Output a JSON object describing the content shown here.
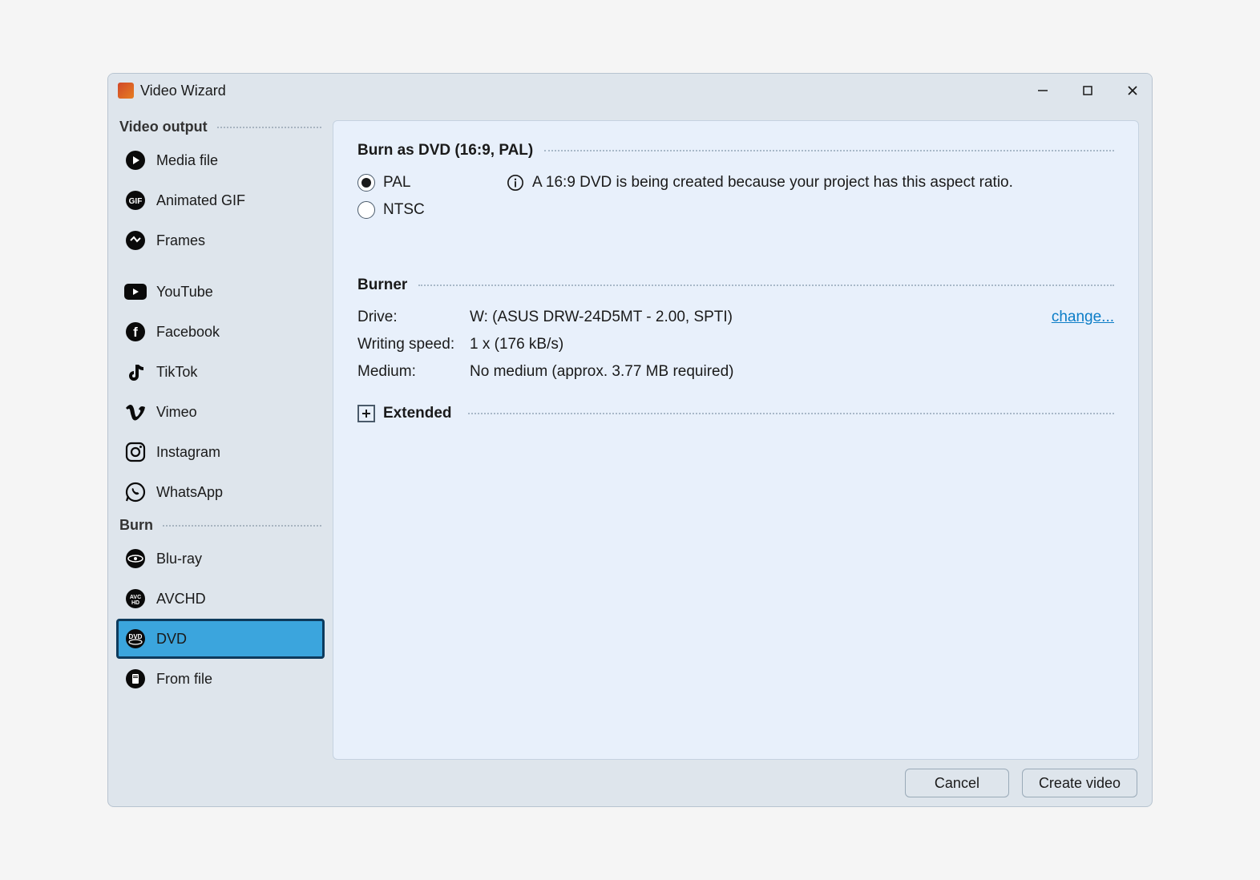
{
  "window": {
    "title": "Video Wizard"
  },
  "sidebar": {
    "sections": [
      {
        "title": "Video output",
        "items": [
          {
            "id": "media-file",
            "label": "Media file",
            "icon": "play-circle"
          },
          {
            "id": "animated-gif",
            "label": "Animated GIF",
            "icon": "gif"
          },
          {
            "id": "frames",
            "label": "Frames",
            "icon": "frames"
          },
          {
            "id": "youtube",
            "label": "YouTube",
            "icon": "youtube"
          },
          {
            "id": "facebook",
            "label": "Facebook",
            "icon": "facebook"
          },
          {
            "id": "tiktok",
            "label": "TikTok",
            "icon": "tiktok"
          },
          {
            "id": "vimeo",
            "label": "Vimeo",
            "icon": "vimeo"
          },
          {
            "id": "instagram",
            "label": "Instagram",
            "icon": "instagram"
          },
          {
            "id": "whatsapp",
            "label": "WhatsApp",
            "icon": "whatsapp"
          }
        ]
      },
      {
        "title": "Burn",
        "items": [
          {
            "id": "bluray",
            "label": "Blu-ray",
            "icon": "bluray"
          },
          {
            "id": "avchd",
            "label": "AVCHD",
            "icon": "avchd"
          },
          {
            "id": "dvd",
            "label": "DVD",
            "icon": "dvd",
            "selected": true
          },
          {
            "id": "from-file",
            "label": "From file",
            "icon": "file-disc"
          }
        ]
      }
    ]
  },
  "main": {
    "group1": {
      "title": "Burn as DVD (16:9, PAL)",
      "radios": [
        {
          "label": "PAL",
          "checked": true
        },
        {
          "label": "NTSC",
          "checked": false
        }
      ],
      "infoText": "A 16:9 DVD is being created because your project has this aspect ratio."
    },
    "group2": {
      "title": "Burner",
      "rows": [
        {
          "label": "Drive:",
          "value": "W: (ASUS DRW-24D5MT - 2.00, SPTI)",
          "change": "change..."
        },
        {
          "label": "Writing speed:",
          "value": "1 x (176 kB/s)"
        },
        {
          "label": "Medium:",
          "value": "No medium (approx. 3.77 MB required)"
        }
      ]
    },
    "extended": "Extended"
  },
  "footer": {
    "cancel": "Cancel",
    "create": "Create video"
  }
}
